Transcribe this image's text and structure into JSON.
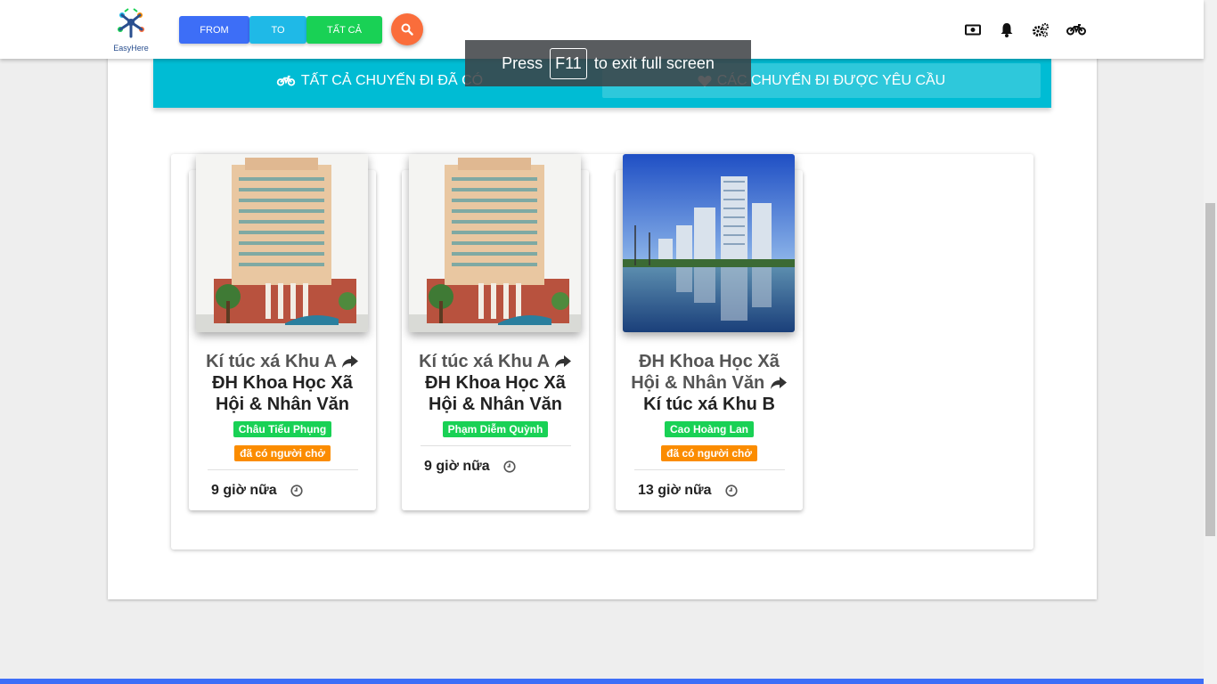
{
  "navbar": {
    "logo_text": "EasyHere",
    "buttons": {
      "from": "FROM",
      "to": "TO",
      "all": "TẤT CẢ"
    },
    "icons": [
      "money-icon",
      "bell-icon",
      "cogs-icon",
      "motorcycle-icon"
    ]
  },
  "fullscreen_notice": {
    "before": "Press",
    "key": "F11",
    "after": "to exit full screen"
  },
  "tabs": {
    "all_trips": "TẤT CẢ CHUYẾN ĐI ĐÃ CÓ",
    "requested_trips": "CÁC CHUYẾN ĐI ĐƯỢC YÊU CẦU"
  },
  "trips": [
    {
      "from": "Kí túc xá Khu A",
      "to": "ĐH Khoa Học Xã Hội & Nhân Văn",
      "driver": "Châu Tiểu Phụng",
      "status": "đã có người chở",
      "time": "9 giờ nữa",
      "image": "university-building"
    },
    {
      "from": "Kí túc xá Khu A",
      "to": "ĐH Khoa Học Xã Hội & Nhân Văn",
      "driver": "Phạm Diễm Quỳnh",
      "status": "",
      "time": "9 giờ nữa",
      "image": "university-building"
    },
    {
      "from": "ĐH Khoa Học Xã Hội & Nhân Văn",
      "to": "Kí túc xá Khu B",
      "driver": "Cao Hoàng Lan",
      "status": "đã có người chở",
      "time": "13 giờ nữa",
      "image": "dormitory-lake"
    }
  ],
  "colors": {
    "primary": "#3d6ef7",
    "cyan": "#00bcd4",
    "green": "#19d155",
    "orange": "#fb8c00",
    "search": "#fa6d3b"
  }
}
